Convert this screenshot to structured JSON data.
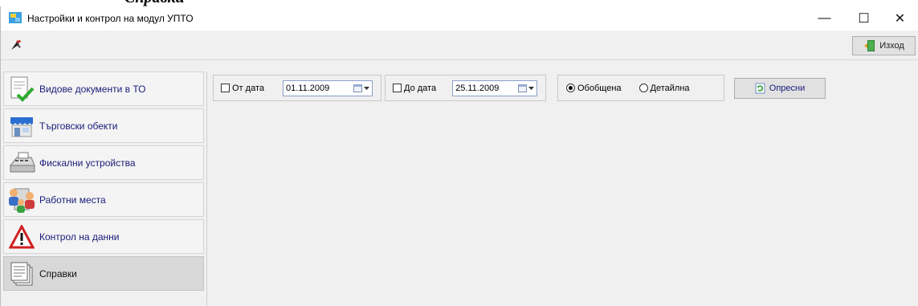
{
  "heading_fragment": "Справки",
  "window": {
    "title": "Настройки и контрол на модул УПТО"
  },
  "titlebar_buttons": {
    "minimize": "—",
    "maximize": "☐",
    "close": "✕"
  },
  "toolbar": {
    "exit_label": "Изход"
  },
  "sidebar": {
    "items": [
      {
        "label": "Видове документи в ТО",
        "icon": "document-check-icon"
      },
      {
        "label": "Търговски обекти",
        "icon": "shop-icon"
      },
      {
        "label": "Фискални устройства",
        "icon": "cash-register-icon"
      },
      {
        "label": "Работни места",
        "icon": "users-icon"
      },
      {
        "label": "Контрол на данни",
        "icon": "warning-icon"
      },
      {
        "label": "Справки",
        "icon": "reports-icon"
      }
    ],
    "active_index": 5
  },
  "filters": {
    "from_label": "От дата",
    "from_value": "01.11.2009",
    "from_checked": false,
    "to_label": "До дата",
    "to_value": "25.11.2009",
    "to_checked": false,
    "mode_summary": "Обобщена",
    "mode_detailed": "Детайлна",
    "mode_selected": "summary",
    "refresh_label": "Опресни"
  },
  "colors": {
    "accent_text": "#1a1a7a",
    "window_bg": "#f0f0f0"
  }
}
